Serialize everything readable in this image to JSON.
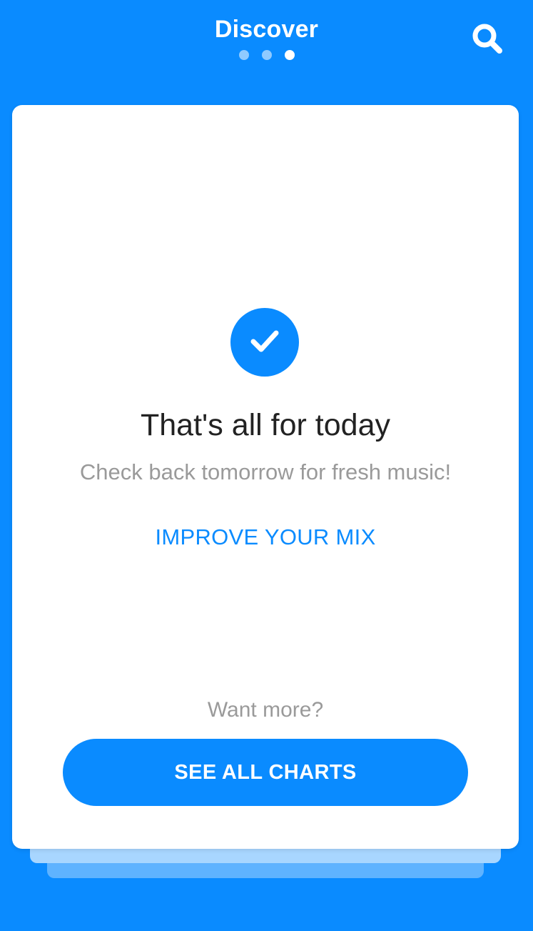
{
  "header": {
    "title": "Discover",
    "page_indicator": {
      "count": 3,
      "active_index": 2
    },
    "search_icon": "search-icon"
  },
  "card": {
    "icon": "checkmark-icon",
    "headline": "That's all for today",
    "subtext": "Check back tomorrow for fresh music!",
    "link_label": "IMPROVE YOUR MIX",
    "prompt": "Want more?",
    "cta_label": "SEE ALL CHARTS"
  },
  "colors": {
    "brand_blue": "#0a8bff",
    "card_bg": "#ffffff",
    "text_dark": "#222222",
    "text_muted": "#9a9a9a"
  }
}
